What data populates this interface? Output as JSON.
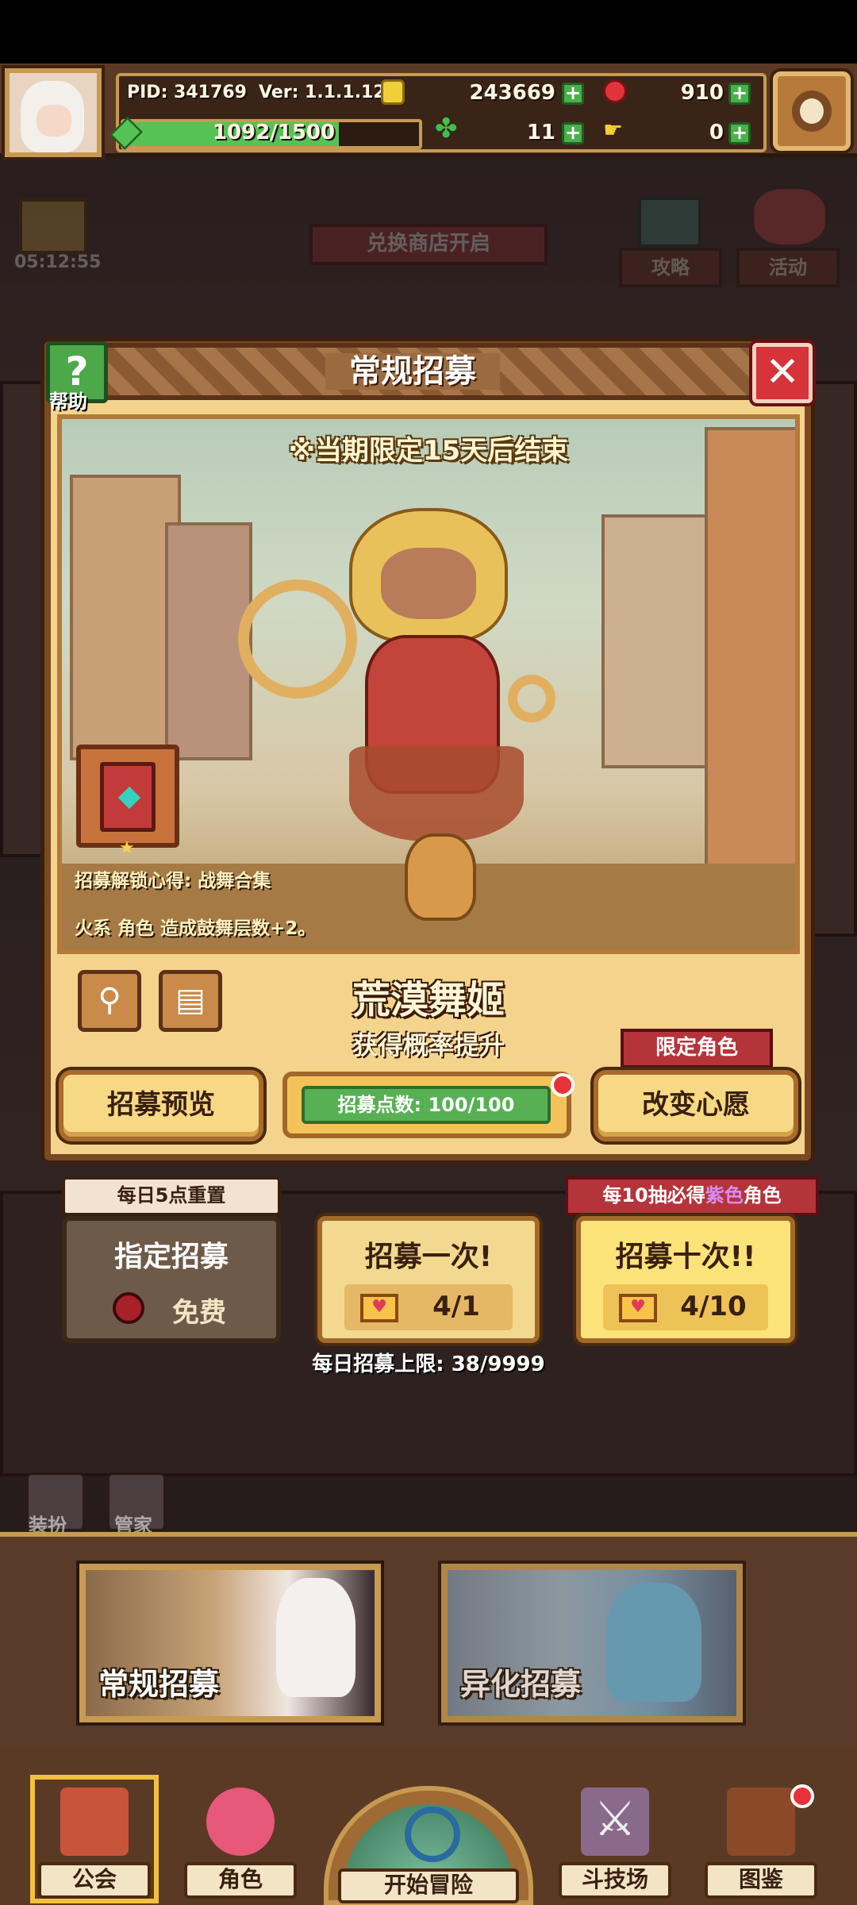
{
  "player": {
    "pid": "PID: 341769",
    "version": "Ver: 1.1.1.12",
    "exp": "1092/1500",
    "exp_fraction": 0.728
  },
  "currencies": {
    "gold": "243669",
    "gems": "910",
    "clover": "11",
    "hand_token": "0"
  },
  "background": {
    "timer": "05:12:55",
    "shop_banner": "兑换商店开启",
    "btn_strategy": "攻略",
    "btn_event": "活动",
    "btn_dress": "装扮",
    "btn_butler": "管家"
  },
  "modal": {
    "title": "常规招募",
    "help_label": "帮助",
    "period_notice": "※当期限定15天后结束",
    "unlock_line": "招募解锁心得: 战舞合集",
    "effect_line": "火系 角色 造成鼓舞层数+2。",
    "char_name": "荒漠舞姬",
    "char_sub": "获得概率提升",
    "preview_button": "招募预览",
    "points": "招募点数: 100/100",
    "limited_tag": "限定角色",
    "wish_button": "改变心愿"
  },
  "recruit": {
    "reset_tag": "每日5点重置",
    "ten_tag_prefix": "每10抽必得",
    "ten_tag_color": "紫色",
    "ten_tag_suffix": "角色",
    "designated_label": "指定招募",
    "designated_cost": "免费",
    "once_label": "招募一次!",
    "once_count": "4/1",
    "ten_label": "招募十次!!",
    "ten_count": "4/10",
    "daily_limit": "每日招募上限: 38/9999"
  },
  "pools": {
    "normal": "常规招募",
    "alien": "异化招募"
  },
  "nav": {
    "guild": "公会",
    "character": "角色",
    "adventure": "开始冒险",
    "arena": "斗技场",
    "codex": "图鉴"
  },
  "colors": {
    "accent_gold": "#c79a52",
    "purple_highlight": "#d78cf5",
    "points_green": "#57b154",
    "alert_red": "#e8323a"
  }
}
